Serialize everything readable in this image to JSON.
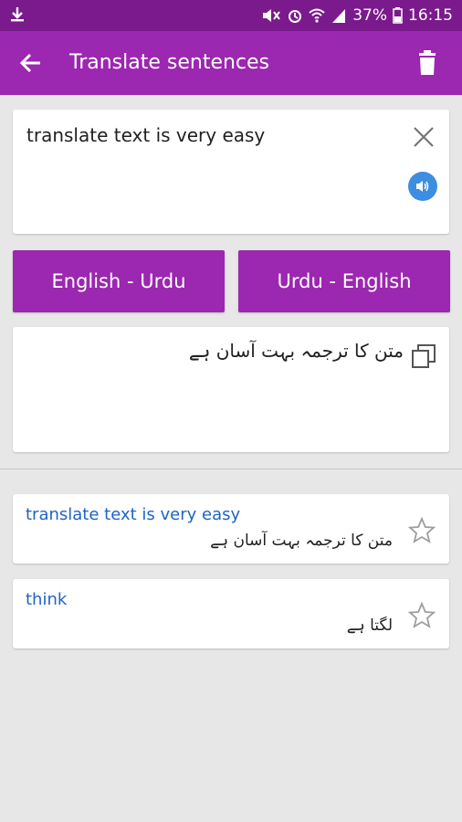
{
  "status_bar": {
    "battery": "37%",
    "time": "16:15"
  },
  "app_bar": {
    "title": "Translate sentences"
  },
  "input": {
    "text": "translate text is very easy"
  },
  "buttons": {
    "english_urdu": "English - Urdu",
    "urdu_english": "Urdu - English"
  },
  "output": {
    "text": "متن کا ترجمہ بہت آسان ہے"
  },
  "history": [
    {
      "source": "translate text is very easy",
      "translation": "متن کا ترجمہ بہت آسان ہے"
    },
    {
      "source": "think",
      "translation": "لگتا ہے"
    }
  ],
  "icons": {
    "back": "arrow-left-icon",
    "delete": "trash-icon",
    "clear": "close-icon",
    "speak": "speaker-icon",
    "copy": "copy-icon",
    "favorite": "star-outline-icon"
  },
  "colors": {
    "primary": "#9c27b0",
    "primary_dark": "#7b1a8c",
    "link": "#1e63c5",
    "speak": "#3d8de0"
  }
}
